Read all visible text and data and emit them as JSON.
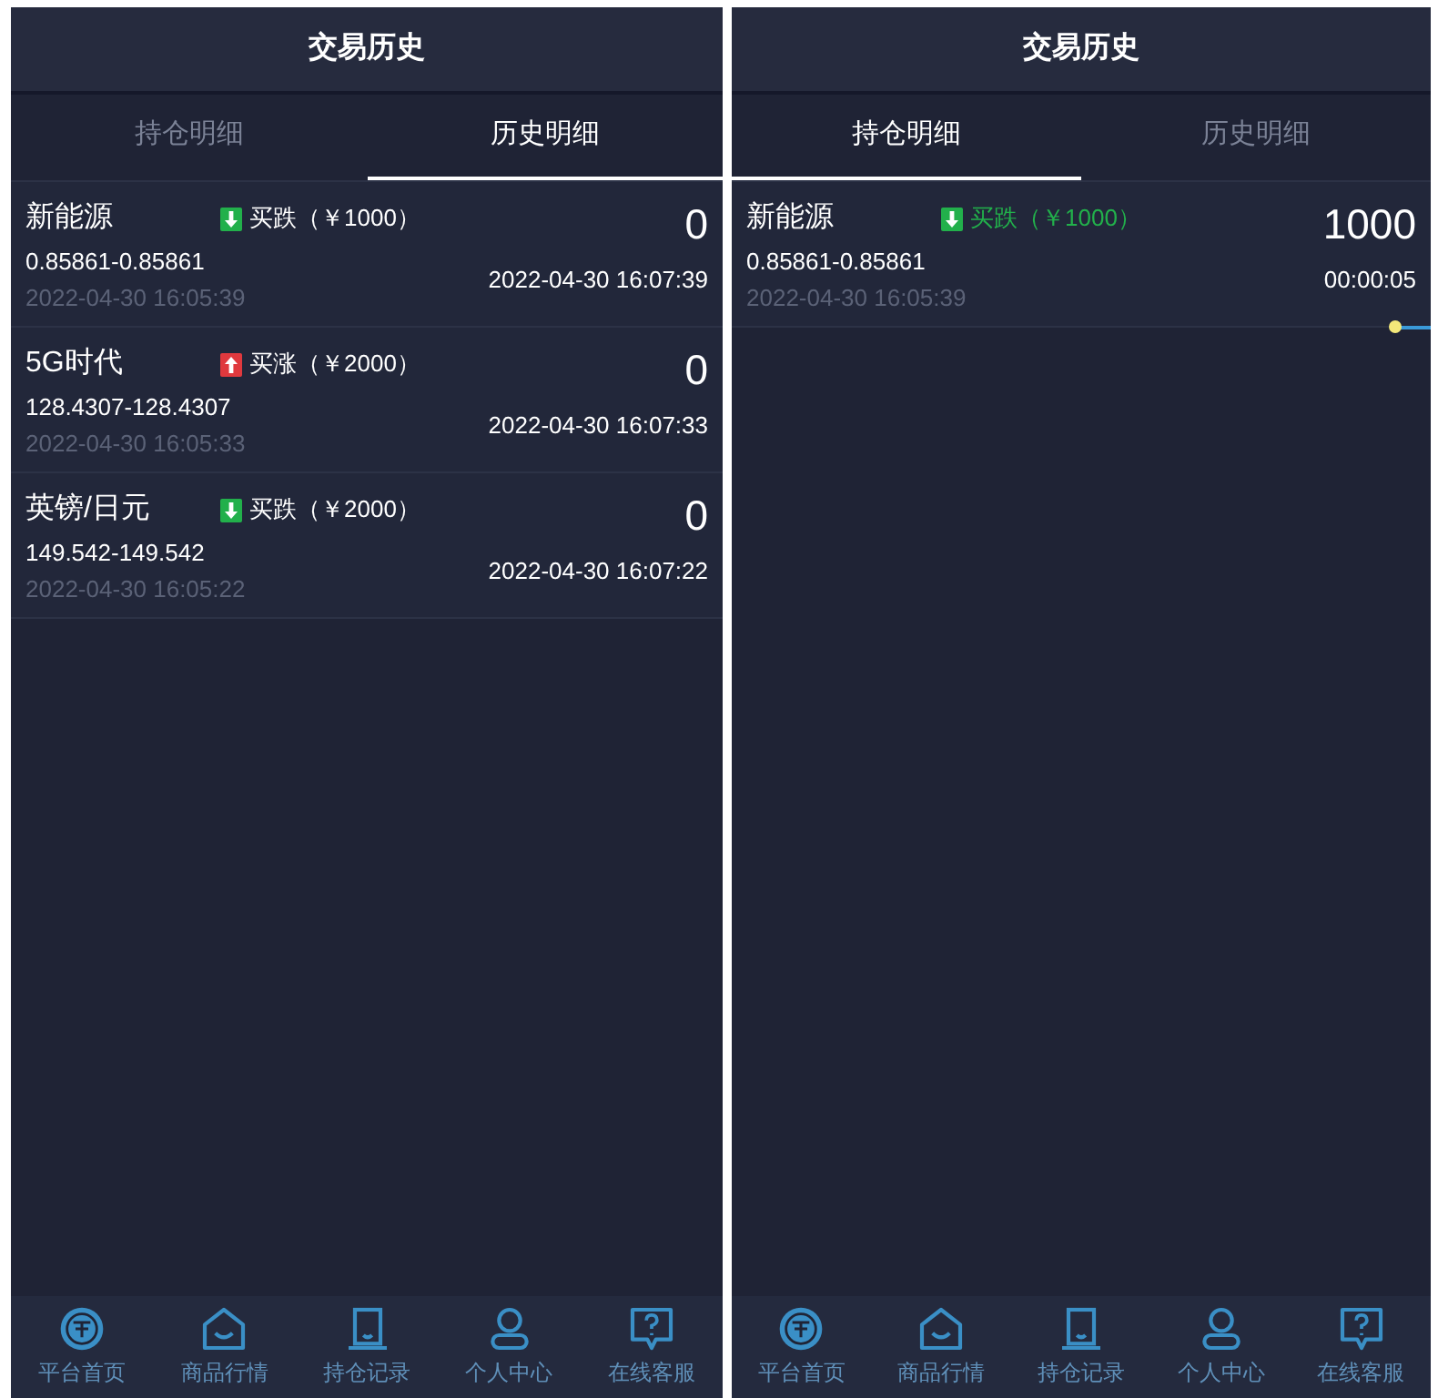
{
  "screens": [
    {
      "title": "交易历史",
      "tabs": [
        {
          "label": "持仓明细",
          "selected": false
        },
        {
          "label": "历史明细",
          "selected": true
        }
      ],
      "rows": [
        {
          "kind": "history",
          "name": "新能源",
          "rising": false,
          "order": "买跌（￥1000）",
          "prices": "0.85861-0.85861",
          "open_time": "2022-04-30 16:05:39",
          "result": "0",
          "right_text": "2022-04-30 16:07:39"
        },
        {
          "kind": "history",
          "name": "5G时代",
          "rising": true,
          "order": "买涨（￥2000）",
          "prices": "128.4307-128.4307",
          "open_time": "2022-04-30 16:05:33",
          "result": "0",
          "right_text": "2022-04-30 16:07:33"
        },
        {
          "kind": "history",
          "name": "英镑/日元",
          "rising": false,
          "order": "买跌（￥2000）",
          "prices": "149.542-149.542",
          "open_time": "2022-04-30 16:05:22",
          "result": "0",
          "right_text": "2022-04-30 16:07:22"
        }
      ],
      "nav": [
        "平台首页",
        "商品行情",
        "持仓记录",
        "个人中心",
        "在线客服"
      ]
    },
    {
      "title": "交易历史",
      "tabs": [
        {
          "label": "持仓明细",
          "selected": true
        },
        {
          "label": "历史明细",
          "selected": false
        }
      ],
      "rows": [
        {
          "kind": "holding",
          "name": "新能源",
          "rising": false,
          "order": "买跌（￥1000）",
          "prices": "0.85861-0.85861",
          "open_time": "2022-04-30 16:05:39",
          "result": "1000",
          "right_text": "00:00:05",
          "level": 0.05
        }
      ],
      "nav": [
        "平台首页",
        "商品行情",
        "持仓记录",
        "个人中心",
        "在线客服"
      ]
    }
  ]
}
